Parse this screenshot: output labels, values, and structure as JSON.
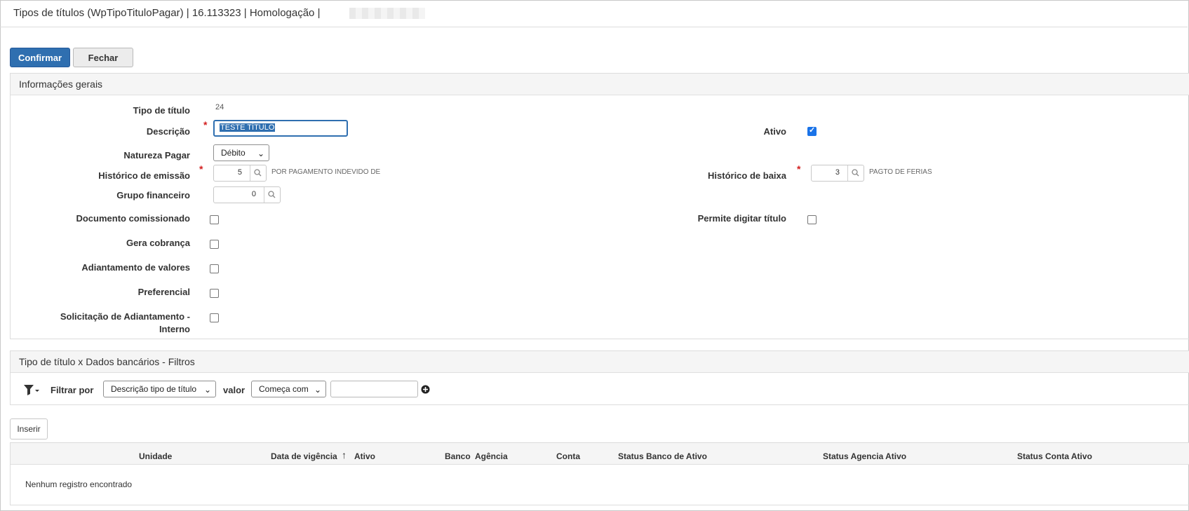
{
  "window": {
    "title": "Tipos de títulos (WpTipoTituloPagar) | 16.113323 | Homologação |"
  },
  "toolbar": {
    "confirm_label": "Confirmar",
    "close_label": "Fechar"
  },
  "general": {
    "title": "Informações gerais",
    "tipo_titulo": {
      "label": "Tipo de título",
      "value": "24"
    },
    "descricao": {
      "label": "Descrição",
      "value": "TESTE TÍTULO"
    },
    "ativo": {
      "label": "Ativo",
      "checked": true
    },
    "natureza": {
      "label": "Natureza Pagar",
      "value": "Débito"
    },
    "hist_emissao": {
      "label": "Histórico de emissão",
      "value": "5",
      "desc": "POR PAGAMENTO INDEVIDO DE"
    },
    "hist_baixa": {
      "label": "Histórico de baixa",
      "value": "3",
      "desc": "PAGTO DE FERIAS"
    },
    "grupo": {
      "label": "Grupo financeiro",
      "value": "0"
    },
    "doc_comissionado": {
      "label": "Documento comissionado",
      "checked": false
    },
    "permite_digitar": {
      "label": "Permite digitar título",
      "checked": false
    },
    "gera_cobranca": {
      "label": "Gera cobrança",
      "checked": false
    },
    "adiantamento": {
      "label": "Adiantamento de valores",
      "checked": false
    },
    "preferencial": {
      "label": "Preferencial",
      "checked": false
    },
    "solicitacao_line1": "Solicitação de Adiantamento -",
    "solicitacao_line2": "Interno",
    "solicitacao_checked": false
  },
  "filters": {
    "title": "Tipo de título x Dados bancários - Filtros",
    "filter_by_label": "Filtrar por",
    "field_option": "Descrição tipo de título",
    "value_label": "valor",
    "operator_option": "Começa com",
    "value_input": "",
    "insert_label": "Inserir"
  },
  "table": {
    "columns": [
      "Unidade",
      "Data de vigência",
      "Ativo",
      "Banco",
      "Agência",
      "Conta",
      "Status Banco de Ativo",
      "Status Agencia Ativo",
      "Status Conta Ativo"
    ],
    "sort_arrow": "↑",
    "empty_message": "Nenhum registro encontrado"
  },
  "colors": {
    "primary": "#2f6fb0",
    "required": "#d32020",
    "checkbox_on": "#1a73e8"
  }
}
